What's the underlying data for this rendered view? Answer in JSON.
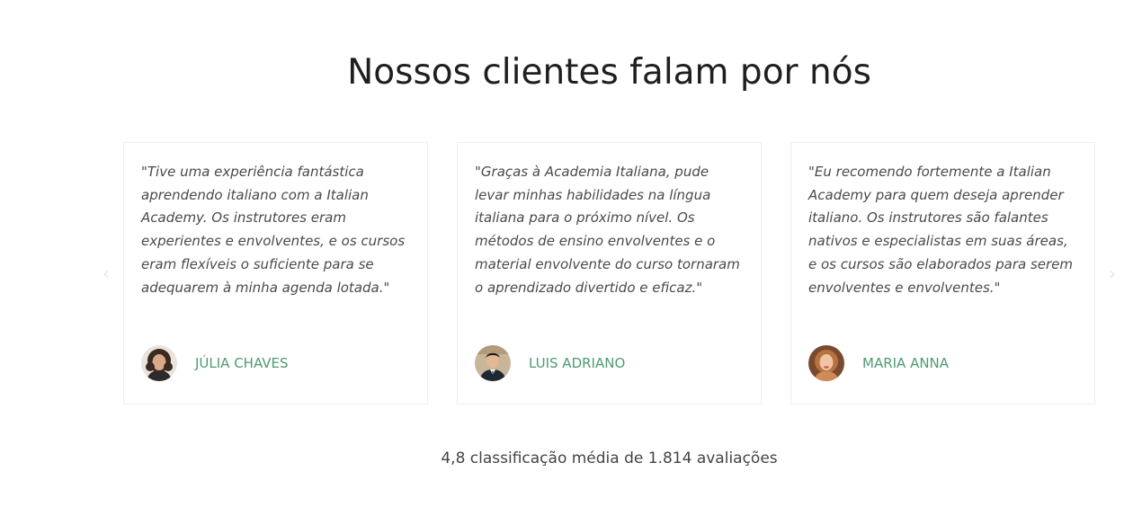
{
  "section": {
    "title": "Nossos clientes falam por nós"
  },
  "carousel": {
    "prev_icon": "chevron-left-icon",
    "next_icon": "chevron-right-icon",
    "prev_glyph": "‹",
    "next_glyph": "›",
    "testimonials": [
      {
        "quote": "\"Tive uma experiência fantástica aprendendo italiano com a Italian Academy. Os instrutores eram experientes e envolventes, e os cursos eram flexíveis o suficiente para se adequarem à minha agenda lotada.\"",
        "name": "JÚLIA CHAVES",
        "avatar_icon": "woman-curly-hair-avatar"
      },
      {
        "quote": "\"Graças à Academia Italiana, pude levar minhas habilidades na língua italiana para o próximo nível. Os métodos de ensino envolventes e o material envolvente do curso tornaram o aprendizado divertido e eficaz.\"",
        "name": "LUIS ADRIANO",
        "avatar_icon": "man-suit-avatar"
      },
      {
        "quote": "\"Eu recomendo fortemente a Italian Academy para quem deseja aprender italiano. Os instrutores são falantes nativos e especialistas em suas áreas, e os cursos são elaborados para serem envolventes e envolventes.\"",
        "name": "MARIA ANNA",
        "avatar_icon": "woman-blonde-avatar"
      }
    ]
  },
  "rating": {
    "text": "4,8 classificação média de 1.814 avaliações"
  },
  "colors": {
    "author_name": "#4f9b72",
    "quote_text": "#4a4a4a",
    "title_text": "#1f1f1f",
    "card_border": "#eeeeee",
    "arrow": "#e6e6e6"
  }
}
